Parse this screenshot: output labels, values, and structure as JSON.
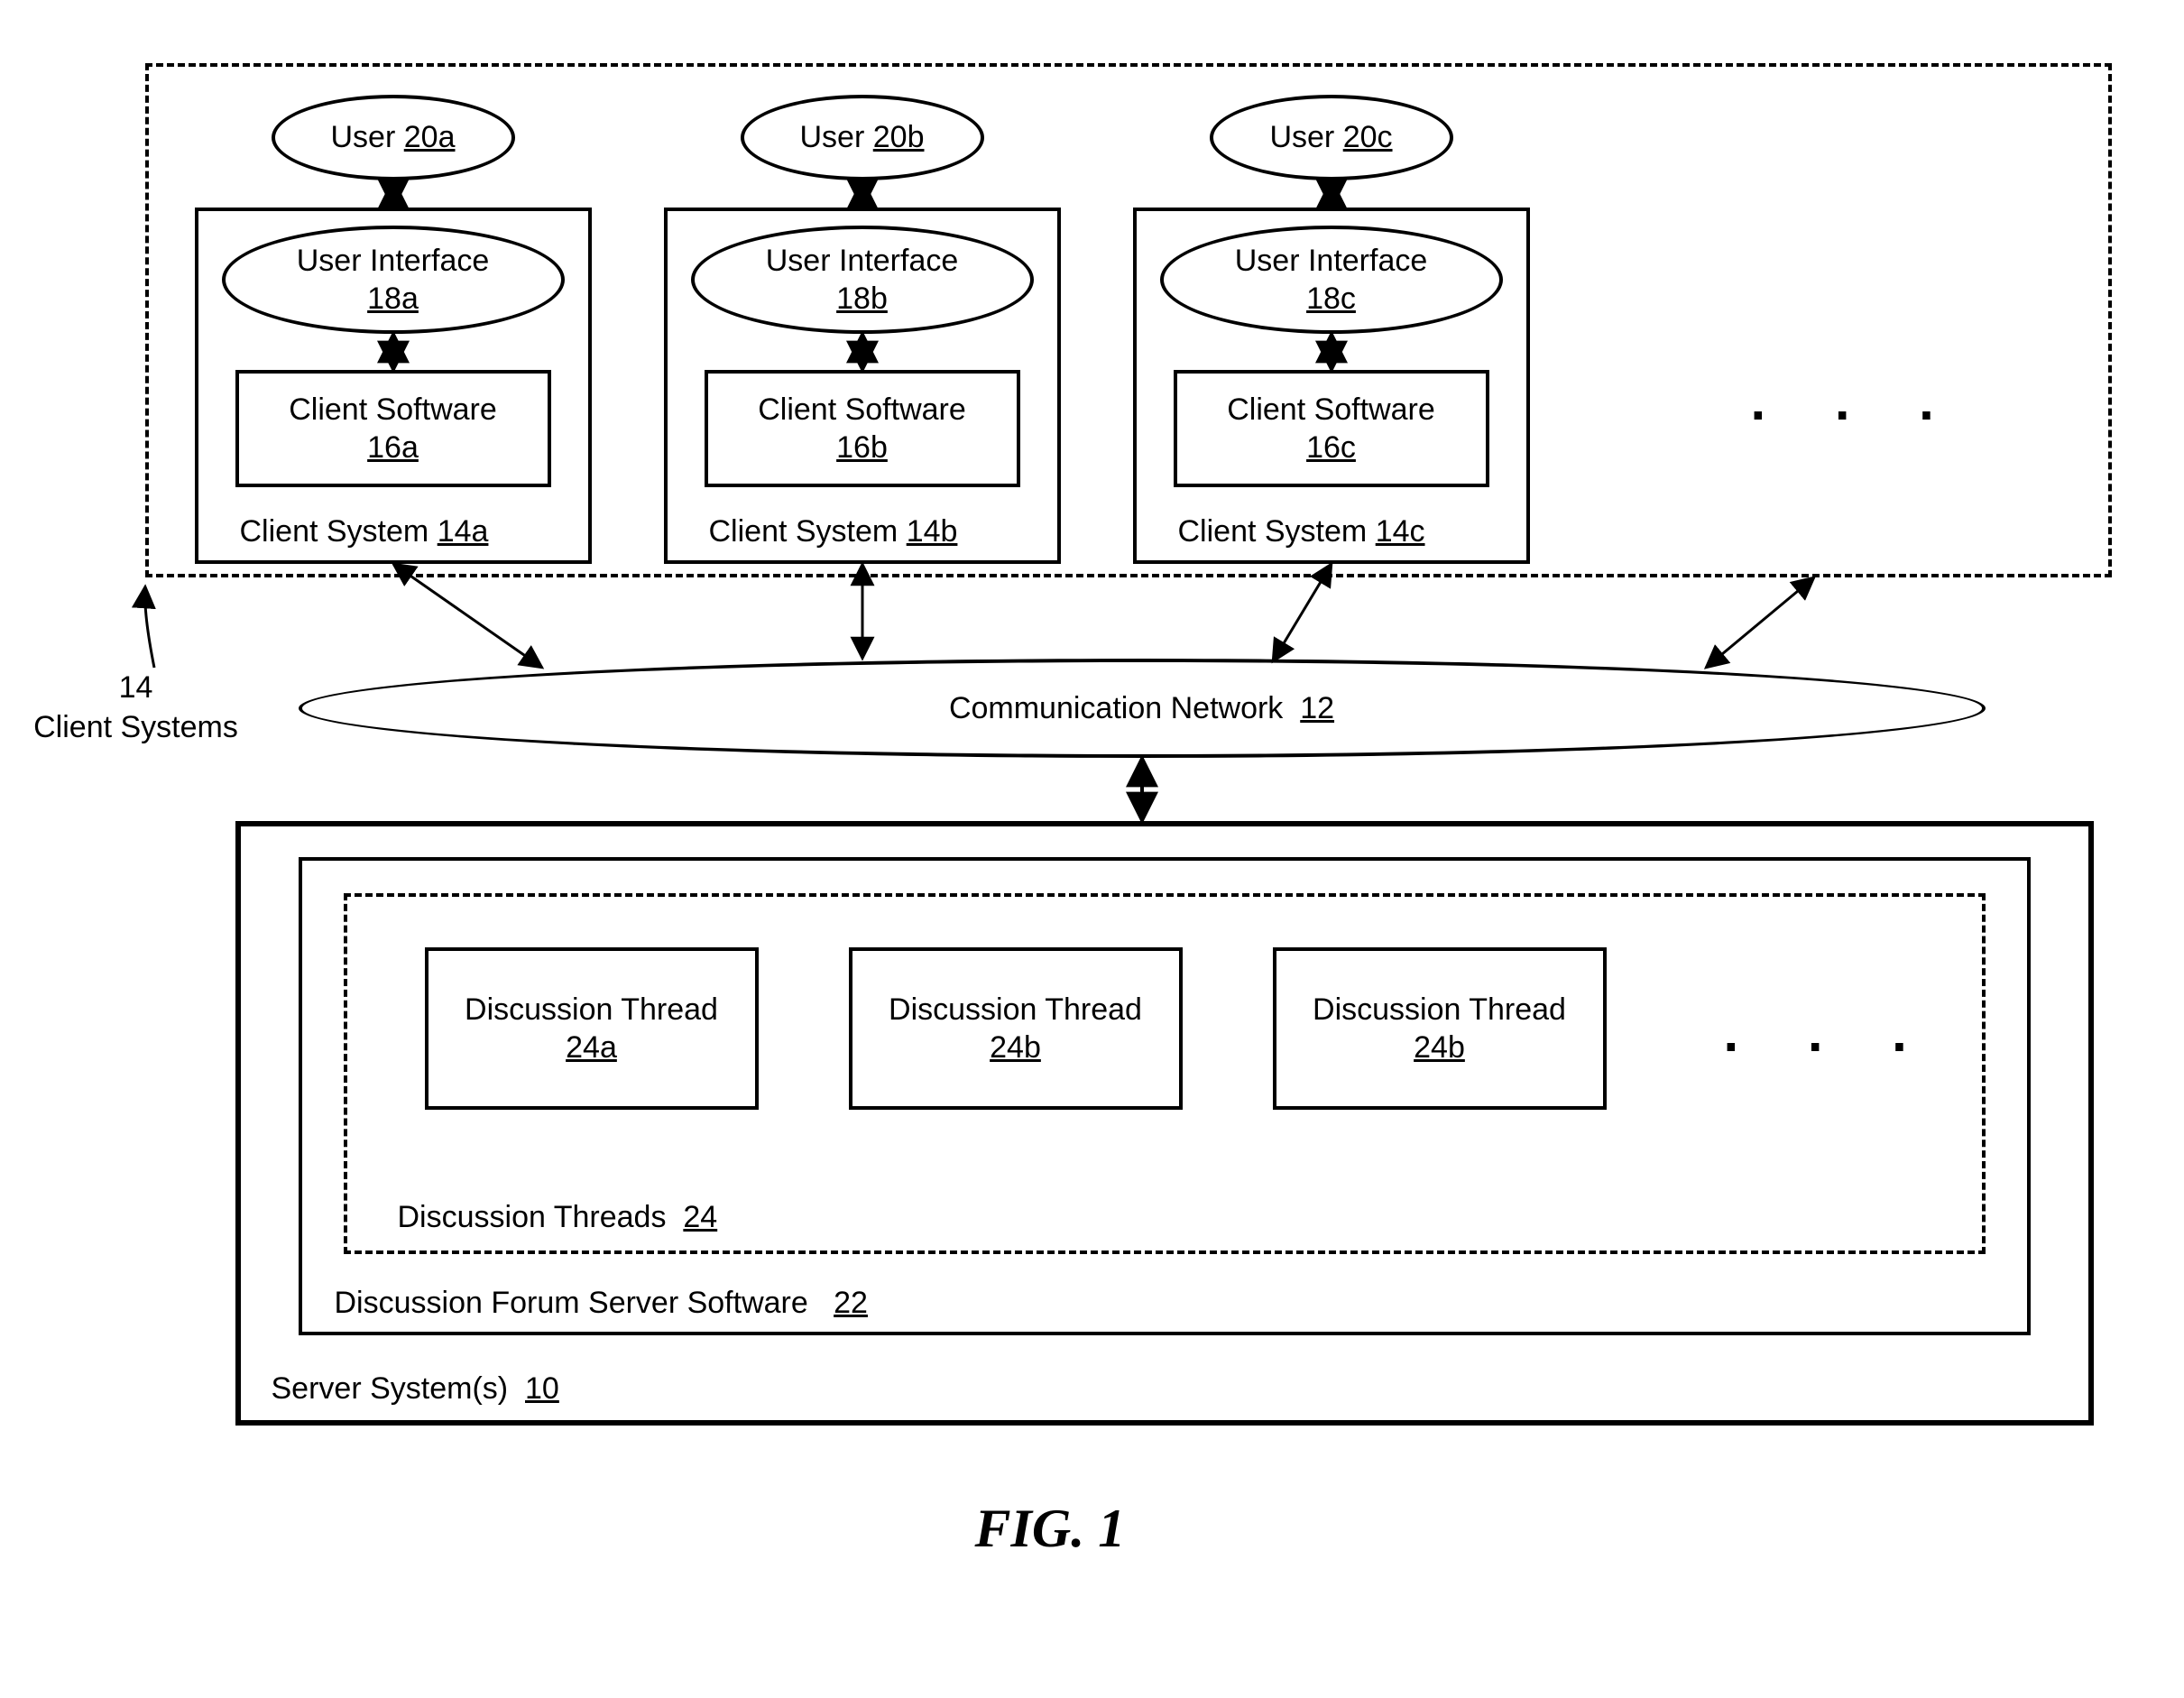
{
  "figure_caption": "FIG. 1",
  "client_systems_group": {
    "side_label_top": "14",
    "side_label_bottom": "Client Systems",
    "ellipsis": ". . .",
    "clients": [
      {
        "user_label": "User",
        "user_ref": "20a",
        "ui_label": "User Interface",
        "ui_ref": "18a",
        "sw_label": "Client Software",
        "sw_ref": "16a",
        "sys_label": "Client System",
        "sys_ref": "14a"
      },
      {
        "user_label": "User",
        "user_ref": "20b",
        "ui_label": "User Interface",
        "ui_ref": "18b",
        "sw_label": "Client Software",
        "sw_ref": "16b",
        "sys_label": "Client System",
        "sys_ref": "14b"
      },
      {
        "user_label": "User",
        "user_ref": "20c",
        "ui_label": "User Interface",
        "ui_ref": "18c",
        "sw_label": "Client Software",
        "sw_ref": "16c",
        "sys_label": "Client System",
        "sys_ref": "14c"
      }
    ]
  },
  "network": {
    "label": "Communication Network",
    "ref": "12"
  },
  "server": {
    "sys_label": "Server System(s)",
    "sys_ref": "10",
    "forum_sw_label": "Discussion Forum Server Software",
    "forum_sw_ref": "22",
    "threads_group_label": "Discussion Threads",
    "threads_group_ref": "24",
    "ellipsis": ". . .",
    "threads": [
      {
        "label": "Discussion Thread",
        "ref": "24a"
      },
      {
        "label": "Discussion Thread",
        "ref": "24b"
      },
      {
        "label": "Discussion Thread",
        "ref": "24b"
      }
    ]
  }
}
